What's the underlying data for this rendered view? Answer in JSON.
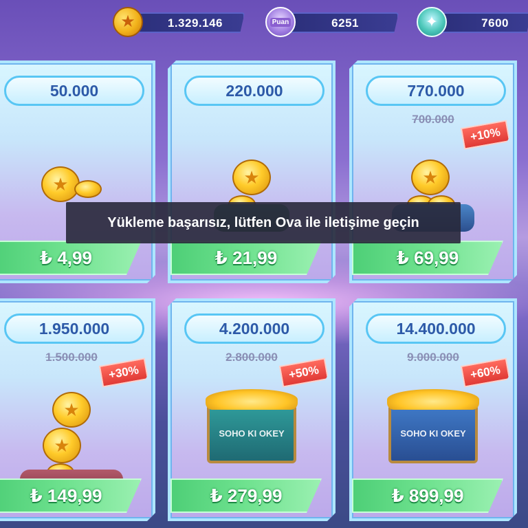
{
  "resources": {
    "coins": {
      "value": "1.329.146",
      "icon": "coin-icon"
    },
    "puan": {
      "value": "6251",
      "icon_label": "Puan",
      "icon": "puan-badge-icon"
    },
    "gems": {
      "value": "7600",
      "icon": "gem-icon"
    }
  },
  "products": [
    {
      "amount": "50.000",
      "old_amount": "",
      "bonus": "",
      "price": "₺ 4,99",
      "art": "coin-stack"
    },
    {
      "amount": "220.000",
      "old_amount": "",
      "bonus": "",
      "price": "₺ 21,99",
      "art": "coins-on-green-pillow"
    },
    {
      "amount": "770.000",
      "old_amount": "700.000",
      "bonus": "+10%",
      "price": "₺ 69,99",
      "art": "coins-on-blue-pillow"
    },
    {
      "amount": "1.950.000",
      "old_amount": "1.500.000",
      "bonus": "+30%",
      "price": "₺ 149,99",
      "art": "coins-on-red-pillow"
    },
    {
      "amount": "4.200.000",
      "old_amount": "2.800.000",
      "bonus": "+50%",
      "price": "₺ 279,99",
      "art": "teal-treasure-chest"
    },
    {
      "amount": "14.400.000",
      "old_amount": "9.000.000",
      "bonus": "+60%",
      "price": "₺ 899,99",
      "art": "blue-treasure-chest"
    }
  ],
  "chest_brand": "SOHO KI OKEY",
  "toast": {
    "message": "Yükleme başarısız, lütfen Ova ile iletişime geçin"
  },
  "colors": {
    "price_green": "#4ecf77",
    "bonus_red": "#e03a36",
    "amount_blue": "#2d5aa8",
    "card_border": "#aee6ff"
  }
}
